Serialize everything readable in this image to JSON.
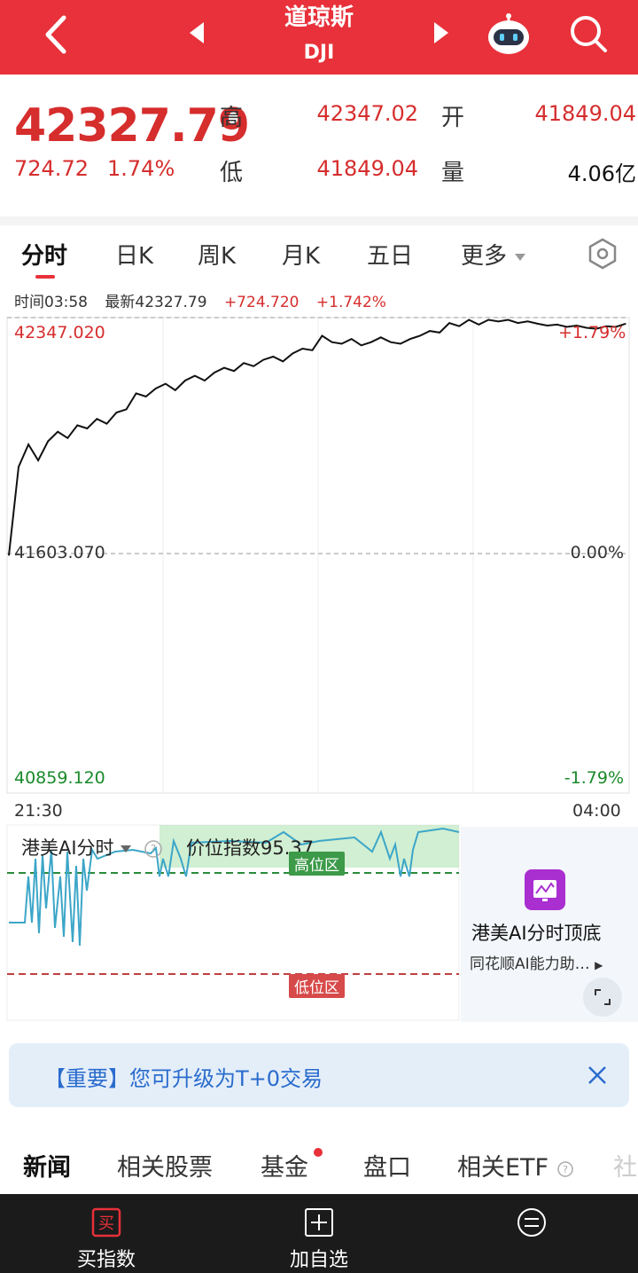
{
  "header": {
    "title": "道琼斯",
    "code": "DJI"
  },
  "quote": {
    "price": "42327.79",
    "change": "724.72",
    "change_pct": "1.74%",
    "high_label": "高",
    "high": "42347.02",
    "open_label": "开",
    "open": "41849.04",
    "low_label": "低",
    "low": "41849.04",
    "volume_label": "量",
    "volume": "4.06亿"
  },
  "tabs": [
    "分时",
    "日K",
    "周K",
    "月K",
    "五日",
    "更多"
  ],
  "info": {
    "time": "时间03:58",
    "latest": "最新42327.79",
    "change": "+724.720",
    "change_pct": "+1.742%"
  },
  "chart_data": {
    "type": "line",
    "y_top_label": "42347.020",
    "y_mid_label": "41603.070",
    "y_bottom_label": "40859.120",
    "pct_top_label": "+1.79%",
    "pct_mid_label": "0.00%",
    "pct_bottom_label": "-1.79%",
    "x_start_label": "21:30",
    "x_end_label": "04:00",
    "ylim": [
      40859.12,
      42347.02
    ],
    "prev_close": 41603.07,
    "values": [
      41603.07,
      41880,
      41950,
      41900,
      41960,
      41990,
      41970,
      42010,
      42000,
      42030,
      42015,
      42050,
      42060,
      42110,
      42100,
      42125,
      42140,
      42120,
      42150,
      42165,
      42150,
      42175,
      42190,
      42180,
      42205,
      42195,
      42215,
      42225,
      42210,
      42235,
      42250,
      42245,
      42290,
      42270,
      42265,
      42280,
      42260,
      42270,
      42285,
      42270,
      42265,
      42280,
      42290,
      42305,
      42300,
      42330,
      42320,
      42340,
      42325,
      42340,
      42335,
      42340,
      42330,
      42335,
      42328,
      42322,
      42325,
      42318,
      42322,
      42315,
      42312,
      42320,
      42318,
      42327.79
    ]
  },
  "ai": {
    "title": "港美AI分时",
    "index_label": "价位指数95.37",
    "high_zone": "高位区",
    "low_zone": "低位区",
    "card_title": "港美AI分时顶底",
    "card_sub": "同花顺AI能力助…"
  },
  "banner": {
    "text": "【重要】您可升级为T+0交易"
  },
  "news_tabs": [
    "新闻",
    "相关股票",
    "基金",
    "盘口",
    "相关ETF",
    "社"
  ],
  "bottom_nav": {
    "buy_icon_text": "买",
    "buy": "买指数",
    "add": "加自选"
  },
  "colors": {
    "brand_red": "#e8313a",
    "up_red": "#d62d2d",
    "down_green": "#1a8a2a",
    "ai_blue": "#3ca6c8"
  }
}
